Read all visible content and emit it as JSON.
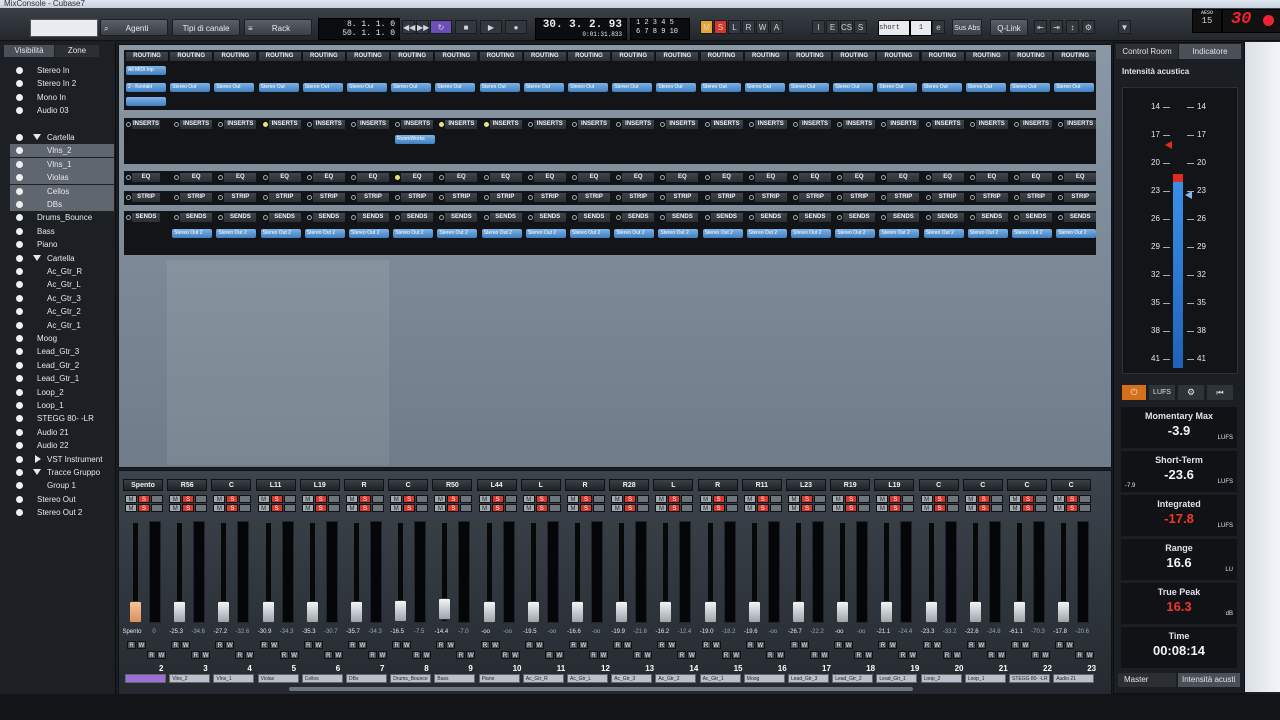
{
  "window": {
    "title": "MixConsole - Cubase7"
  },
  "toolbar": {
    "agenti": "Agenti",
    "tipi_canale": "Tipi di canale",
    "rack": "Rack",
    "left_locator": "8. 1. 1. 0",
    "right_locator": "50. 1. 1. 0",
    "position_bars": "30. 3. 2. 93",
    "position_time": "0:01:31.833",
    "markers_top": "1 2 3 4 5",
    "markers_bottom": "6 7 8 9 10",
    "toggles": [
      "M",
      "S",
      "L",
      "R",
      "W",
      "A"
    ],
    "edit_btns": [
      "I",
      "E",
      "CS",
      "S"
    ],
    "shortcut_value": "short",
    "shortcut_num": "1",
    "sus_abs": "Sus Abs",
    "qlink": "Q-Link",
    "corner_label": "AESO",
    "corner_num": "15",
    "big_counter": "30"
  },
  "leftpanel": {
    "tab_visibility": "Visibilità",
    "tab_zones": "Zone",
    "items": [
      {
        "label": "Stereo In",
        "indent": 0,
        "kind": "channel"
      },
      {
        "label": "Stereo In 2",
        "indent": 0,
        "kind": "channel"
      },
      {
        "label": "Mono In",
        "indent": 0,
        "kind": "channel"
      },
      {
        "label": "Audio 03",
        "indent": 0,
        "kind": "channel"
      },
      {
        "label": "",
        "indent": 0,
        "kind": "blank"
      },
      {
        "label": "Cartella",
        "indent": 0,
        "kind": "folder-open"
      },
      {
        "label": "Vlns_2",
        "indent": 1,
        "kind": "channel",
        "selected": true
      },
      {
        "label": "Vlns_1",
        "indent": 1,
        "kind": "channel",
        "selected": true
      },
      {
        "label": "Violas",
        "indent": 1,
        "kind": "channel",
        "selected": true
      },
      {
        "label": "Cellos",
        "indent": 1,
        "kind": "channel",
        "selected": true
      },
      {
        "label": "DBs",
        "indent": 1,
        "kind": "channel",
        "selected": true
      },
      {
        "label": "Drums_Bounce",
        "indent": 0,
        "kind": "channel"
      },
      {
        "label": "Bass",
        "indent": 0,
        "kind": "channel"
      },
      {
        "label": "Piano",
        "indent": 0,
        "kind": "channel"
      },
      {
        "label": "Cartella",
        "indent": 0,
        "kind": "folder-open"
      },
      {
        "label": "Ac_Gtr_R",
        "indent": 1,
        "kind": "channel"
      },
      {
        "label": "Ac_Gtr_L",
        "indent": 1,
        "kind": "channel"
      },
      {
        "label": "Ac_Gtr_3",
        "indent": 1,
        "kind": "channel"
      },
      {
        "label": "Ac_Gtr_2",
        "indent": 1,
        "kind": "channel"
      },
      {
        "label": "Ac_Gtr_1",
        "indent": 1,
        "kind": "channel"
      },
      {
        "label": "Moog",
        "indent": 0,
        "kind": "channel"
      },
      {
        "label": "Lead_Gtr_3",
        "indent": 0,
        "kind": "channel"
      },
      {
        "label": "Lead_Gtr_2",
        "indent": 0,
        "kind": "channel"
      },
      {
        "label": "Lead_Gtr_1",
        "indent": 0,
        "kind": "channel"
      },
      {
        "label": "Loop_2",
        "indent": 0,
        "kind": "channel"
      },
      {
        "label": "Loop_1",
        "indent": 0,
        "kind": "channel"
      },
      {
        "label": "STEGG 80- -LR",
        "indent": 0,
        "kind": "channel"
      },
      {
        "label": "Audio 21",
        "indent": 0,
        "kind": "channel"
      },
      {
        "label": "Audio 22",
        "indent": 0,
        "kind": "channel"
      },
      {
        "label": "VST Instrument",
        "indent": 0,
        "kind": "folder-closed"
      },
      {
        "label": "Tracce Gruppo",
        "indent": 0,
        "kind": "folder-open"
      },
      {
        "label": "Group 1",
        "indent": 1,
        "kind": "channel"
      },
      {
        "label": "Stereo Out",
        "indent": 0,
        "kind": "channel"
      },
      {
        "label": "Stereo Out 2",
        "indent": 0,
        "kind": "channel"
      }
    ]
  },
  "rack": {
    "routing_label": "ROUTING",
    "inserts_label": "INSERTS",
    "eq_label": "EQ",
    "strip_label": "STRIP",
    "sends_label": "SENDS",
    "stereo_out": "Stereo Out",
    "stereo_out_2": "Stereo Out 2",
    "input_1": "All MIDI Inp",
    "input_2": "2 - Kontakt",
    "insert_plugin": "RoomWorks"
  },
  "mixer": {
    "channels": [
      {
        "pan": "Spento",
        "num": "2",
        "vals": [
          "Spento",
          "0"
        ],
        "fader": 0.05,
        "name": "",
        "accent": true
      },
      {
        "pan": "R56",
        "num": "3",
        "vals": [
          "-25.3",
          "-34.6"
        ],
        "fader": 0.3,
        "name": "Vlns_2"
      },
      {
        "pan": "C",
        "num": "4",
        "vals": [
          "-27.2",
          "-32.6"
        ],
        "fader": 0.27,
        "name": "Vlns_1"
      },
      {
        "pan": "L11",
        "num": "5",
        "vals": [
          "-30.9",
          "-34.3"
        ],
        "fader": 0.24,
        "name": "Violas"
      },
      {
        "pan": "L19",
        "num": "6",
        "vals": [
          "-35.3",
          "-30.7"
        ],
        "fader": 0.2,
        "name": "Cellos"
      },
      {
        "pan": "R",
        "num": "7",
        "vals": [
          "-35.7",
          "-34.3"
        ],
        "fader": 0.2,
        "name": "DBs"
      },
      {
        "pan": "C",
        "num": "8",
        "vals": [
          "-16.5",
          "-7.5"
        ],
        "fader": 0.4,
        "name": "Drums_Bounce"
      },
      {
        "pan": "R50",
        "num": "9",
        "vals": [
          "-14.4",
          "-7.0"
        ],
        "fader": 0.42,
        "name": "Bass"
      },
      {
        "pan": "L44",
        "num": "10",
        "vals": [
          "-oo",
          "-oo"
        ],
        "fader": 0.1,
        "name": "Piano"
      },
      {
        "pan": "L",
        "num": "11",
        "vals": [
          "-19.5",
          "-oo"
        ],
        "fader": 0.36,
        "name": "Ac_Gtr_R"
      },
      {
        "pan": "R",
        "num": "12",
        "vals": [
          "-16.6",
          "-oo"
        ],
        "fader": 0.39,
        "name": "Ac_Gtr_L"
      },
      {
        "pan": "R28",
        "num": "13",
        "vals": [
          "-19.9",
          "-21.6"
        ],
        "fader": 0.35,
        "name": "Ac_Gtr_3"
      },
      {
        "pan": "L",
        "num": "14",
        "vals": [
          "-16.2",
          "-12.4"
        ],
        "fader": 0.39,
        "name": "Ac_Gtr_2"
      },
      {
        "pan": "R",
        "num": "15",
        "vals": [
          "-19.0",
          "-18.2"
        ],
        "fader": 0.36,
        "name": "Ac_Gtr_1"
      },
      {
        "pan": "R11",
        "num": "16",
        "vals": [
          "-19.6",
          "-oo"
        ],
        "fader": 0.35,
        "name": "Moog"
      },
      {
        "pan": "L23",
        "num": "17",
        "vals": [
          "-26.7",
          "-22.2"
        ],
        "fader": 0.28,
        "name": "Lead_Gtr_3"
      },
      {
        "pan": "R19",
        "num": "18",
        "vals": [
          "-oo",
          "-oo"
        ],
        "fader": 0.1,
        "name": "Lead_Gtr_2"
      },
      {
        "pan": "L19",
        "num": "19",
        "vals": [
          "-21.1",
          "-24.4"
        ],
        "fader": 0.33,
        "name": "Lead_Gtr_1"
      },
      {
        "pan": "C",
        "num": "20",
        "vals": [
          "-23.3",
          "-33.2"
        ],
        "fader": 0.31,
        "name": "Loop_2"
      },
      {
        "pan": "C",
        "num": "21",
        "vals": [
          "-22.6",
          "-24.8"
        ],
        "fader": 0.32,
        "name": "Loop_1"
      },
      {
        "pan": "C",
        "num": "22",
        "vals": [
          "-61.1",
          "-70.3"
        ],
        "fader": 0.15,
        "name": "STEGG 80- -LR"
      },
      {
        "pan": "C",
        "num": "23",
        "vals": [
          "-17.8",
          "-20.6"
        ],
        "fader": 0.38,
        "name": "Audio 21"
      }
    ]
  },
  "rightpanel": {
    "tab_control_room": "Control Room",
    "tab_meter": "Indicatore",
    "section_title": "Intensità acustica",
    "scale": [
      "14",
      "17",
      "20",
      "23",
      "26",
      "29",
      "32",
      "35",
      "38",
      "41"
    ],
    "lufs_btn": "LUFS",
    "stats": [
      {
        "label": "Momentary Max",
        "value": "-3.9",
        "unit": "LUFS",
        "red": false
      },
      {
        "label": "Short-Term",
        "value": "-23.6",
        "unit": "LUFS",
        "red": false,
        "side": "-7.9"
      },
      {
        "label": "Integrated",
        "value": "-17.8",
        "unit": "LUFS",
        "red": true
      },
      {
        "label": "Range",
        "value": "16.6",
        "unit": "LU",
        "red": false
      },
      {
        "label": "True Peak",
        "value": "16.3",
        "unit": "dB",
        "red": true
      },
      {
        "label": "Time",
        "value": "00:08:14",
        "unit": "",
        "red": false
      }
    ],
    "bottom_tab_master": "Master",
    "bottom_tab_loudness": "Intensità acusti"
  }
}
